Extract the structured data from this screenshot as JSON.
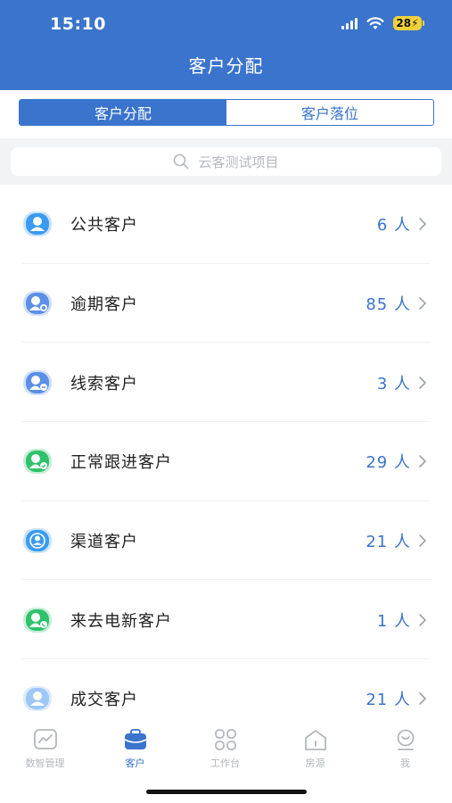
{
  "status": {
    "time": "15:10",
    "battery": "28"
  },
  "header": {
    "title": "客户分配"
  },
  "segments": [
    {
      "label": "客户分配",
      "active": true
    },
    {
      "label": "客户落位",
      "active": false
    }
  ],
  "search": {
    "placeholder": "云客测试项目"
  },
  "customer_groups": [
    {
      "label": "公共客户",
      "count": "6 人",
      "icon": "customer-avatar-icon",
      "color": "#3a9bf0"
    },
    {
      "label": "逾期客户",
      "count": "85 人",
      "icon": "overdue-customer-icon",
      "color": "#5b8fe8"
    },
    {
      "label": "线索客户",
      "count": "3 人",
      "icon": "lead-customer-icon",
      "color": "#5b8fe8"
    },
    {
      "label": "正常跟进客户",
      "count": "29 人",
      "icon": "following-customer-icon",
      "color": "#2fc26b"
    },
    {
      "label": "渠道客户",
      "count": "21 人",
      "icon": "channel-customer-icon",
      "color": "#3a9bf0"
    },
    {
      "label": "来去电新客户",
      "count": "1 人",
      "icon": "call-customer-icon",
      "color": "#2fc26b"
    },
    {
      "label": "成交客户",
      "count": "21 人",
      "icon": "deal-customer-icon",
      "color": "#9cc7f7"
    }
  ],
  "tabs": [
    {
      "label": "数智管理",
      "icon": "chart-icon",
      "active": false
    },
    {
      "label": "客户",
      "icon": "briefcase-icon",
      "active": true
    },
    {
      "label": "工作台",
      "icon": "grid-icon",
      "active": false
    },
    {
      "label": "房源",
      "icon": "house-icon",
      "active": false
    },
    {
      "label": "我",
      "icon": "profile-icon",
      "active": false
    }
  ],
  "colors": {
    "primary": "#3a74cc",
    "inactive": "#b3b6bc",
    "text": "#222222"
  }
}
